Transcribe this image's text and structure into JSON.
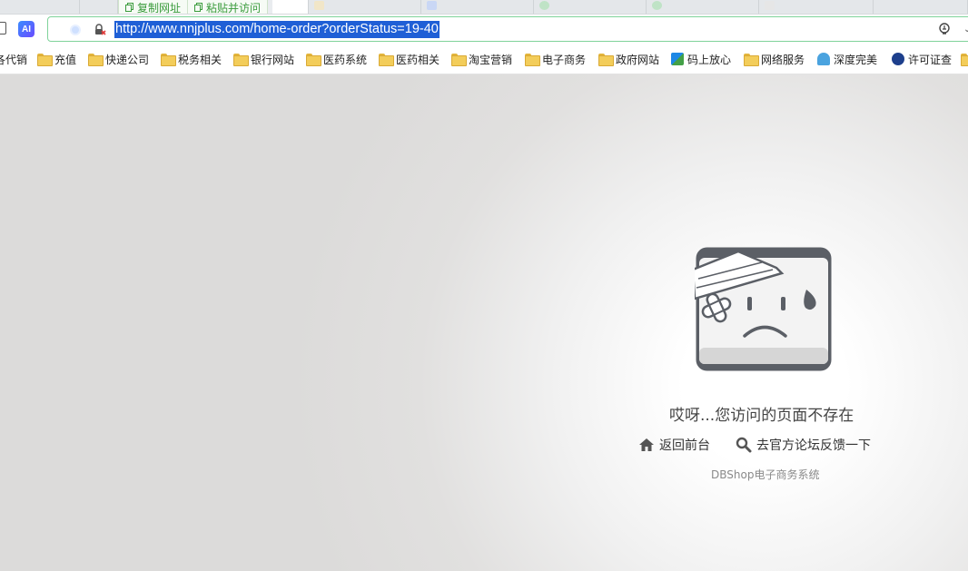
{
  "toolbar": {
    "copy_url_label": "复制网址",
    "paste_go_label": "粘贴并访问"
  },
  "addressbar": {
    "ai_label": "AI",
    "url": "http://www.nnjplus.com/home-order?orderStatus=19-40"
  },
  "bookmarks": [
    {
      "label": "各代销",
      "icon": "folder-icon"
    },
    {
      "label": "充值",
      "icon": "folder-icon"
    },
    {
      "label": "快递公司",
      "icon": "folder-icon"
    },
    {
      "label": "税务相关",
      "icon": "folder-icon"
    },
    {
      "label": "银行网站",
      "icon": "folder-icon"
    },
    {
      "label": "医药系统",
      "icon": "folder-icon"
    },
    {
      "label": "医药相关",
      "icon": "folder-icon"
    },
    {
      "label": "淘宝营销",
      "icon": "folder-icon"
    },
    {
      "label": "电子商务",
      "icon": "folder-icon"
    },
    {
      "label": "政府网站",
      "icon": "folder-icon"
    },
    {
      "label": "码上放心",
      "icon": "site-icon"
    },
    {
      "label": "网络服务",
      "icon": "folder-icon"
    },
    {
      "label": "深度完美",
      "icon": "site-icon"
    },
    {
      "label": "许可证查",
      "icon": "site-icon"
    }
  ],
  "error_page": {
    "title": "哎呀...您访问的页面不存在",
    "back_link": "返回前台",
    "feedback_link": "去官方论坛反馈一下",
    "brand": "DBShop电子商务系统"
  },
  "colors": {
    "copy_green": "#3a9b3c",
    "url_highlight": "#1f5fd6",
    "folder_yellow": "#f3cd5a"
  }
}
